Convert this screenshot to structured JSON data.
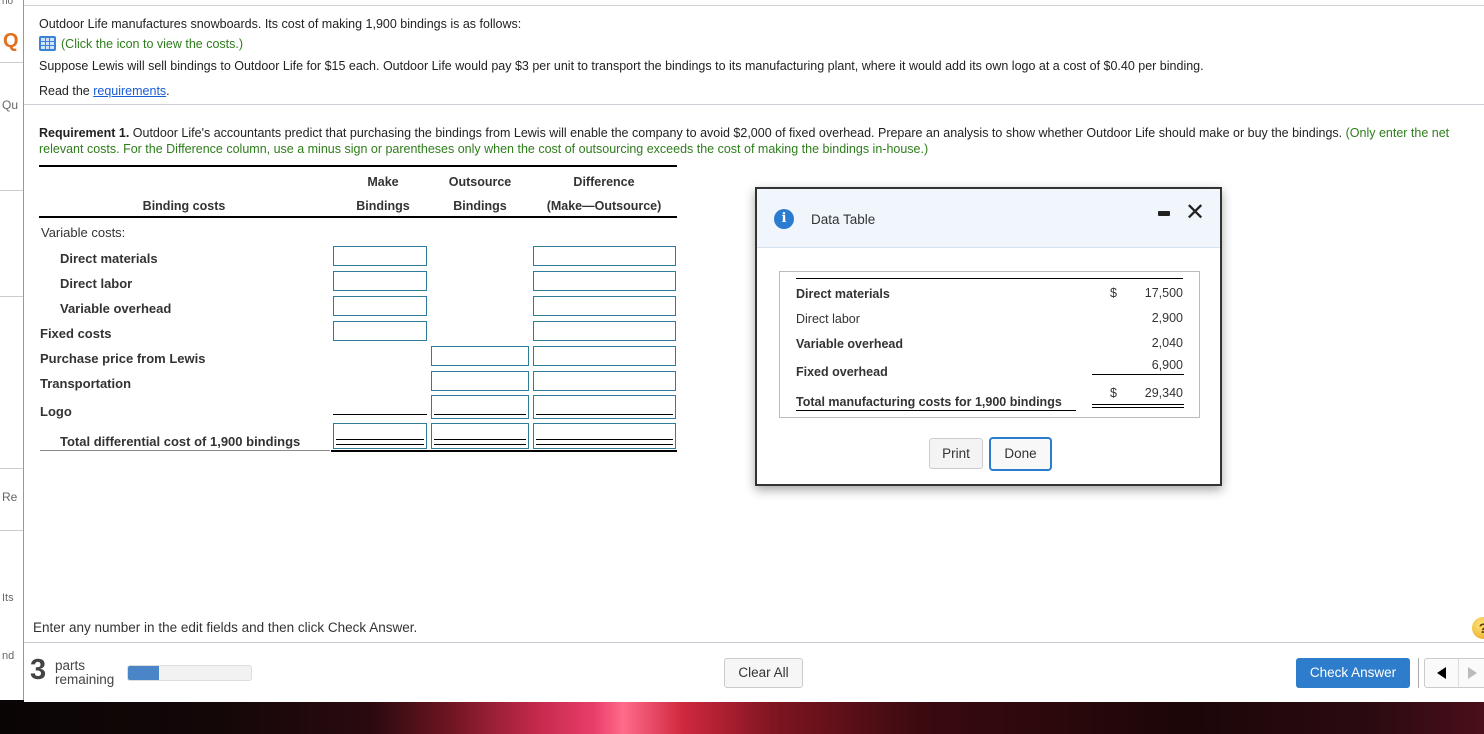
{
  "background_page": {
    "fragments": [
      "ho",
      "Q",
      "Qu",
      "Re",
      "Its",
      "nd"
    ]
  },
  "problem": {
    "intro": "Outdoor Life manufactures snowboards. Its cost of making 1,900 bindings is as follows:",
    "icon_hint": "(Click the icon to view the costs.)",
    "scenario": "Suppose Lewis will sell bindings to Outdoor Life for $15 each. Outdoor Life would pay $3 per unit to transport the bindings to its manufacturing plant, where it would add its own logo at a cost of $0.40 per binding.",
    "read_prefix": "Read the ",
    "read_link": "requirements",
    "read_suffix": "."
  },
  "requirement": {
    "label": "Requirement 1.",
    "text": " Outdoor Life's accountants predict that purchasing the bindings from Lewis will enable the company to avoid $2,000 of fixed overhead. Prepare an analysis to show whether Outdoor Life should make or buy the bindings. ",
    "hint": "(Only enter the net relevant costs. For the Difference column, use a minus sign or parentheses only when the cost of outsourcing exceeds the cost of making the bindings in-house.)"
  },
  "analysis_table": {
    "header": {
      "row_label": "Binding costs",
      "col_make_1": "Make",
      "col_make_2": "Bindings",
      "col_out_1": "Outsource",
      "col_out_2": "Bindings",
      "col_diff_1": "Difference",
      "col_diff_2": "(Make—Outsource)"
    },
    "rows": {
      "variable_costs": "Variable costs:",
      "direct_materials": "Direct materials",
      "direct_labor": "Direct labor",
      "variable_overhead": "Variable overhead",
      "fixed_costs": "Fixed costs",
      "purchase_price": "Purchase price from Lewis",
      "transportation": "Transportation",
      "logo": "Logo",
      "total": "Total differential cost of 1,900 bindings"
    },
    "inputs": {
      "direct_materials_make": "",
      "direct_materials_diff": "",
      "direct_labor_make": "",
      "direct_labor_diff": "",
      "variable_overhead_make": "",
      "variable_overhead_diff": "",
      "fixed_costs_make": "",
      "fixed_costs_diff": "",
      "purchase_price_out": "",
      "purchase_price_diff": "",
      "transportation_out": "",
      "transportation_diff": "",
      "logo_out": "",
      "logo_diff": "",
      "total_make": "",
      "total_out": "",
      "total_diff": ""
    }
  },
  "data_table_modal": {
    "title": "Data Table",
    "rows": [
      {
        "label": "Direct materials",
        "currency": "$",
        "value": "17,500"
      },
      {
        "label": "Direct labor",
        "currency": "",
        "value": "2,900"
      },
      {
        "label": "Variable overhead",
        "currency": "",
        "value": "2,040"
      },
      {
        "label": "Fixed overhead",
        "currency": "",
        "value": "6,900"
      }
    ],
    "total": {
      "label": "Total manufacturing costs for 1,900 bindings",
      "currency": "$",
      "value": "29,340"
    },
    "print_label": "Print",
    "done_label": "Done"
  },
  "footer": {
    "instruction": "Enter any number in the edit fields and then click Check Answer.",
    "parts_count": "3",
    "parts_label_1": "parts",
    "parts_label_2": "remaining",
    "progress_fraction": 0.25,
    "clear_all_label": "Clear All",
    "check_answer_label": "Check Answer",
    "help_label": "?"
  },
  "colors": {
    "accent_blue": "#2e7ccc",
    "hint_green": "#2e7d1b",
    "input_border": "#2e7b9a",
    "progress_fill": "#4a86c7"
  }
}
